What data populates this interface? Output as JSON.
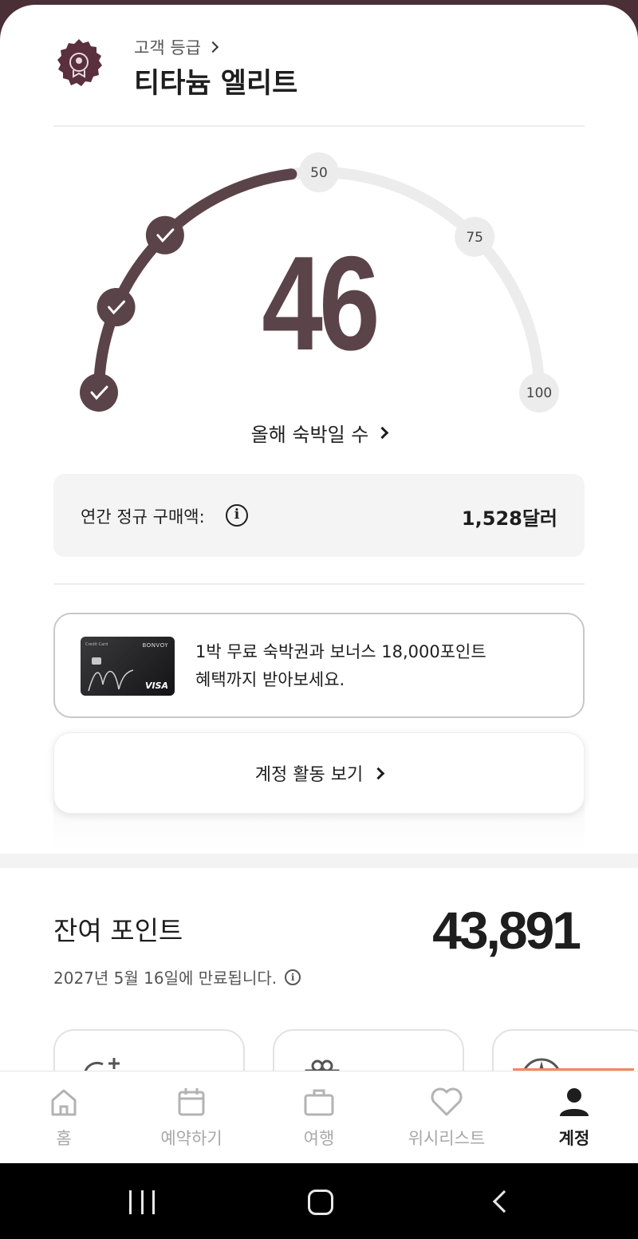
{
  "tier": {
    "label": "고객 등급",
    "name": "티타늄 엘리트"
  },
  "gauge": {
    "nights": "46",
    "nights_value": 46,
    "max_nights": 100,
    "milestones": [
      "50",
      "75",
      "100"
    ],
    "completed_checks": 3,
    "nights_label": "올해 숙박일 수",
    "accent_color": "#5a4349",
    "track_color": "#ececec"
  },
  "spend": {
    "label": "연간 정규 구매액:",
    "value": "1,528달러"
  },
  "promo": {
    "card_brand": "BONVOY",
    "card_network": "VISA",
    "line1": "1박 무료 숙박권과 보너스 18,000포인트",
    "line2": "혜택까지 받아보세요."
  },
  "activity": {
    "label": "계정 활동 보기"
  },
  "points": {
    "title": "잔여 포인트",
    "value": "43,891",
    "expiry": "2027년 5월 16일에 만료됩니다."
  },
  "nav": {
    "items": [
      {
        "label": "홈",
        "icon": "home-icon"
      },
      {
        "label": "예약하기",
        "icon": "calendar-icon"
      },
      {
        "label": "여행",
        "icon": "suitcase-icon"
      },
      {
        "label": "위시리스트",
        "icon": "heart-icon"
      },
      {
        "label": "계정",
        "icon": "person-icon",
        "active": true
      }
    ],
    "accent_color": "#f08a5d"
  }
}
